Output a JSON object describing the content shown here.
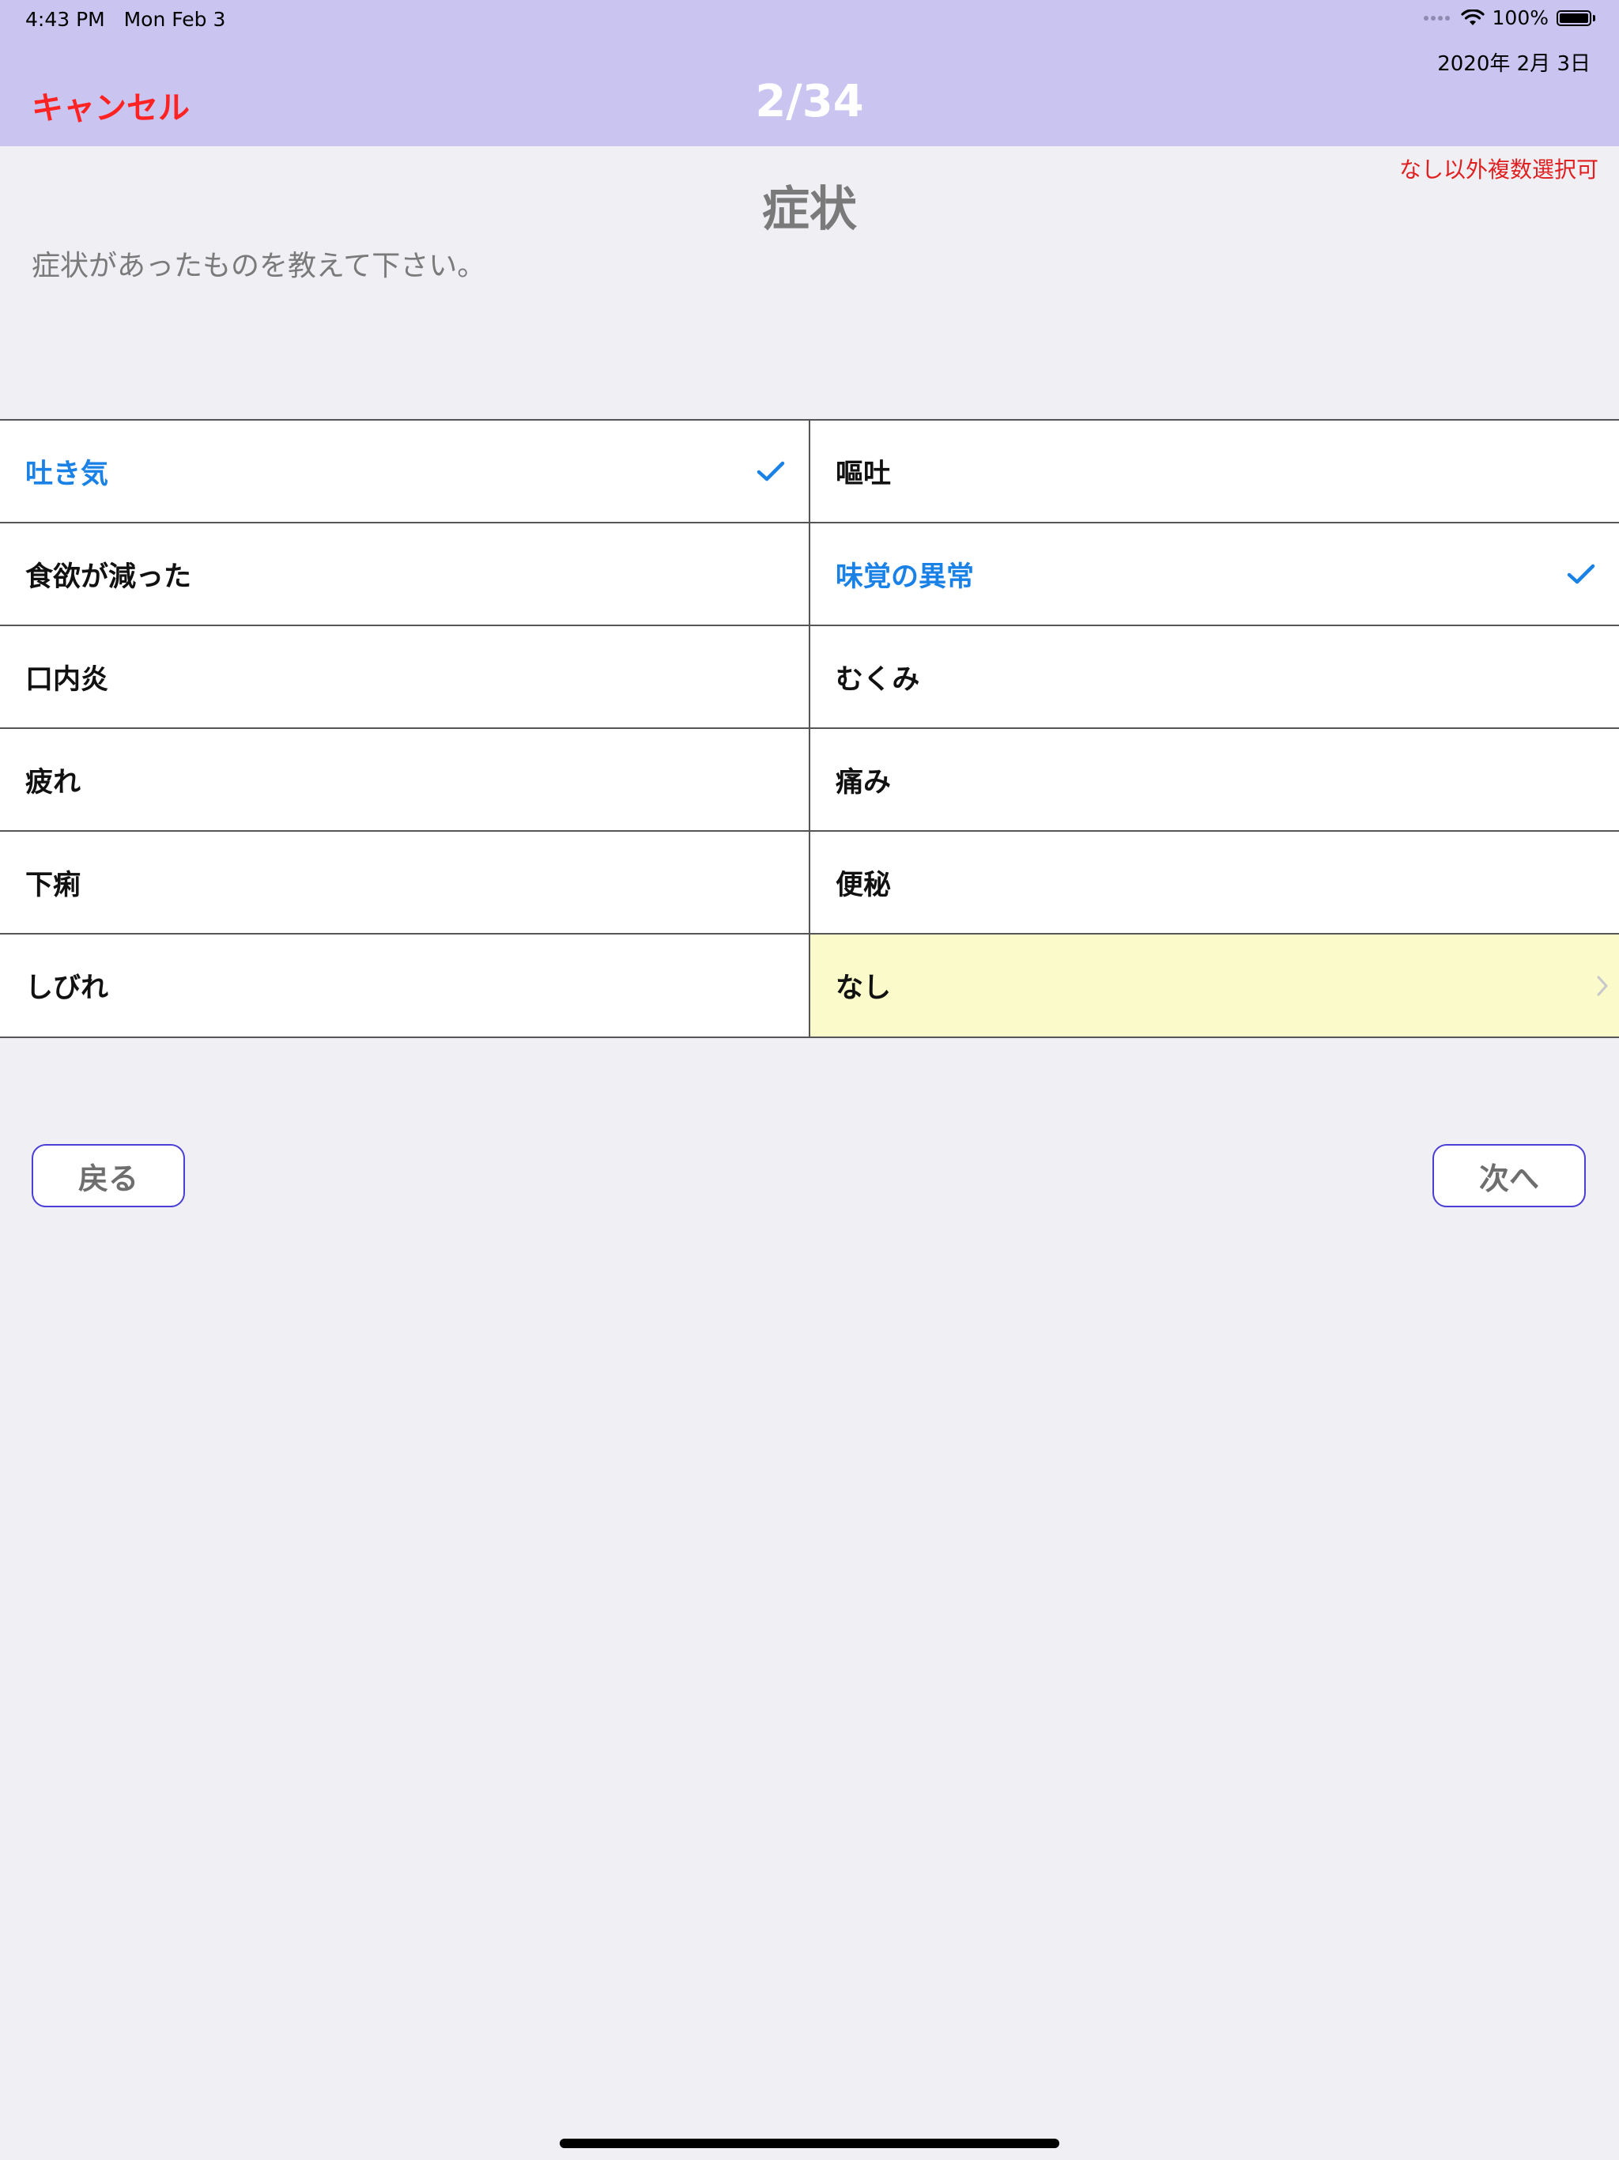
{
  "status_bar": {
    "time": "4:43 PM",
    "day": "Mon Feb 3",
    "battery_text": "100%",
    "battery_level": 1.0
  },
  "header": {
    "date": "2020年  2月  3日",
    "cancel_label": "キャンセル",
    "progress": "2/34",
    "background_color": "#c9c4f0",
    "cancel_color": "#ff2222"
  },
  "question": {
    "note": "なし以外複数選択可",
    "title": "症状",
    "text": "症状があったものを教えて下さい。"
  },
  "options": [
    {
      "label": "吐き気",
      "selected": true
    },
    {
      "label": "嘔吐",
      "selected": false
    },
    {
      "label": "食欲が減った",
      "selected": false
    },
    {
      "label": "味覚の異常",
      "selected": true
    },
    {
      "label": "口内炎",
      "selected": false
    },
    {
      "label": "むくみ",
      "selected": false
    },
    {
      "label": "疲れ",
      "selected": false
    },
    {
      "label": "痛み",
      "selected": false
    },
    {
      "label": "下痢",
      "selected": false
    },
    {
      "label": "便秘",
      "selected": false
    },
    {
      "label": "しびれ",
      "selected": false
    },
    {
      "label": "なし",
      "selected": false,
      "highlighted": true,
      "icon": "chevron-right-icon"
    }
  ],
  "colors": {
    "selected_text": "#1a82e6",
    "highlight_bg": "#fafaca",
    "button_border": "#4a3ed6",
    "note_color": "#e02020"
  },
  "nav": {
    "back_label": "戻る",
    "next_label": "次へ"
  }
}
